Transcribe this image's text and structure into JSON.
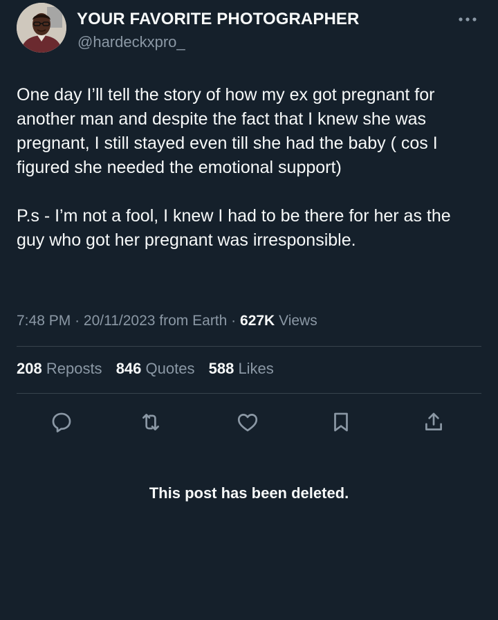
{
  "author": {
    "name": "YOUR FAVORITE PHOTOGRAPHER",
    "handle": "@hardeckxpro_"
  },
  "tweet": {
    "paragraphs": [
      "One day I’ll tell the story of how my ex got pregnant for another man and despite the fact that I knew she was pregnant, I still stayed even till she had the baby ( cos I figured she needed the emotional support)",
      "P.s - I’m not a fool, I knew I had to be there for her as the guy who got her pregnant was irresponsible."
    ]
  },
  "meta": {
    "time": "7:48 PM",
    "date": "20/11/2023",
    "source": "from Earth",
    "separator": "·",
    "views_count": "627K",
    "views_label": "Views"
  },
  "stats": {
    "reposts": {
      "count": "208",
      "label": "Reposts"
    },
    "quotes": {
      "count": "846",
      "label": "Quotes"
    },
    "likes": {
      "count": "588",
      "label": "Likes"
    }
  },
  "actions": [
    "reply-icon",
    "repost-icon",
    "like-icon",
    "bookmark-icon",
    "share-icon"
  ],
  "notice": "This post has been deleted.",
  "colors": {
    "background": "#15202b",
    "text": "#f7f9f9",
    "secondary": "#8b98a5",
    "divider": "#38444d"
  }
}
